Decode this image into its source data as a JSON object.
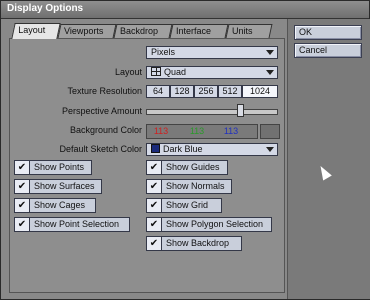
{
  "window": {
    "title": "Display Options"
  },
  "buttons": {
    "ok": "OK",
    "cancel": "Cancel"
  },
  "tabs": [
    {
      "label": "Layout"
    },
    {
      "label": "Viewports"
    },
    {
      "label": "Backdrop"
    },
    {
      "label": "Interface"
    },
    {
      "label": "Units"
    }
  ],
  "units_select": {
    "value": "Pixels"
  },
  "layout": {
    "label": "Layout",
    "value": "Quad"
  },
  "texture": {
    "label": "Texture Resolution",
    "options": [
      "64",
      "128",
      "256",
      "512",
      "1024"
    ],
    "selected": "1024"
  },
  "perspective": {
    "label": "Perspective Amount",
    "level": 0.72
  },
  "background": {
    "label": "Background Color",
    "r": "113",
    "g": "113",
    "b": "113",
    "r_color": "#d02020",
    "g_color": "#2a9a2a",
    "b_color": "#2030c0"
  },
  "sketch": {
    "label": "Default Sketch Color",
    "value": "Dark Blue",
    "swatch": "#1a2a7a"
  },
  "left_checks": [
    {
      "label": "Show Points",
      "checked": "✔"
    },
    {
      "label": "Show Surfaces",
      "checked": "✔"
    },
    {
      "label": "Show Cages",
      "checked": "✔"
    },
    {
      "label": "Show Point Selection",
      "checked": "✔"
    }
  ],
  "right_checks": [
    {
      "label": "Show Guides",
      "checked": "✔"
    },
    {
      "label": "Show Normals",
      "checked": "✔"
    },
    {
      "label": "Show Grid",
      "checked": "✔"
    },
    {
      "label": "Show Polygon Selection",
      "checked": "✔"
    },
    {
      "label": "Show Backdrop",
      "checked": "✔"
    }
  ]
}
